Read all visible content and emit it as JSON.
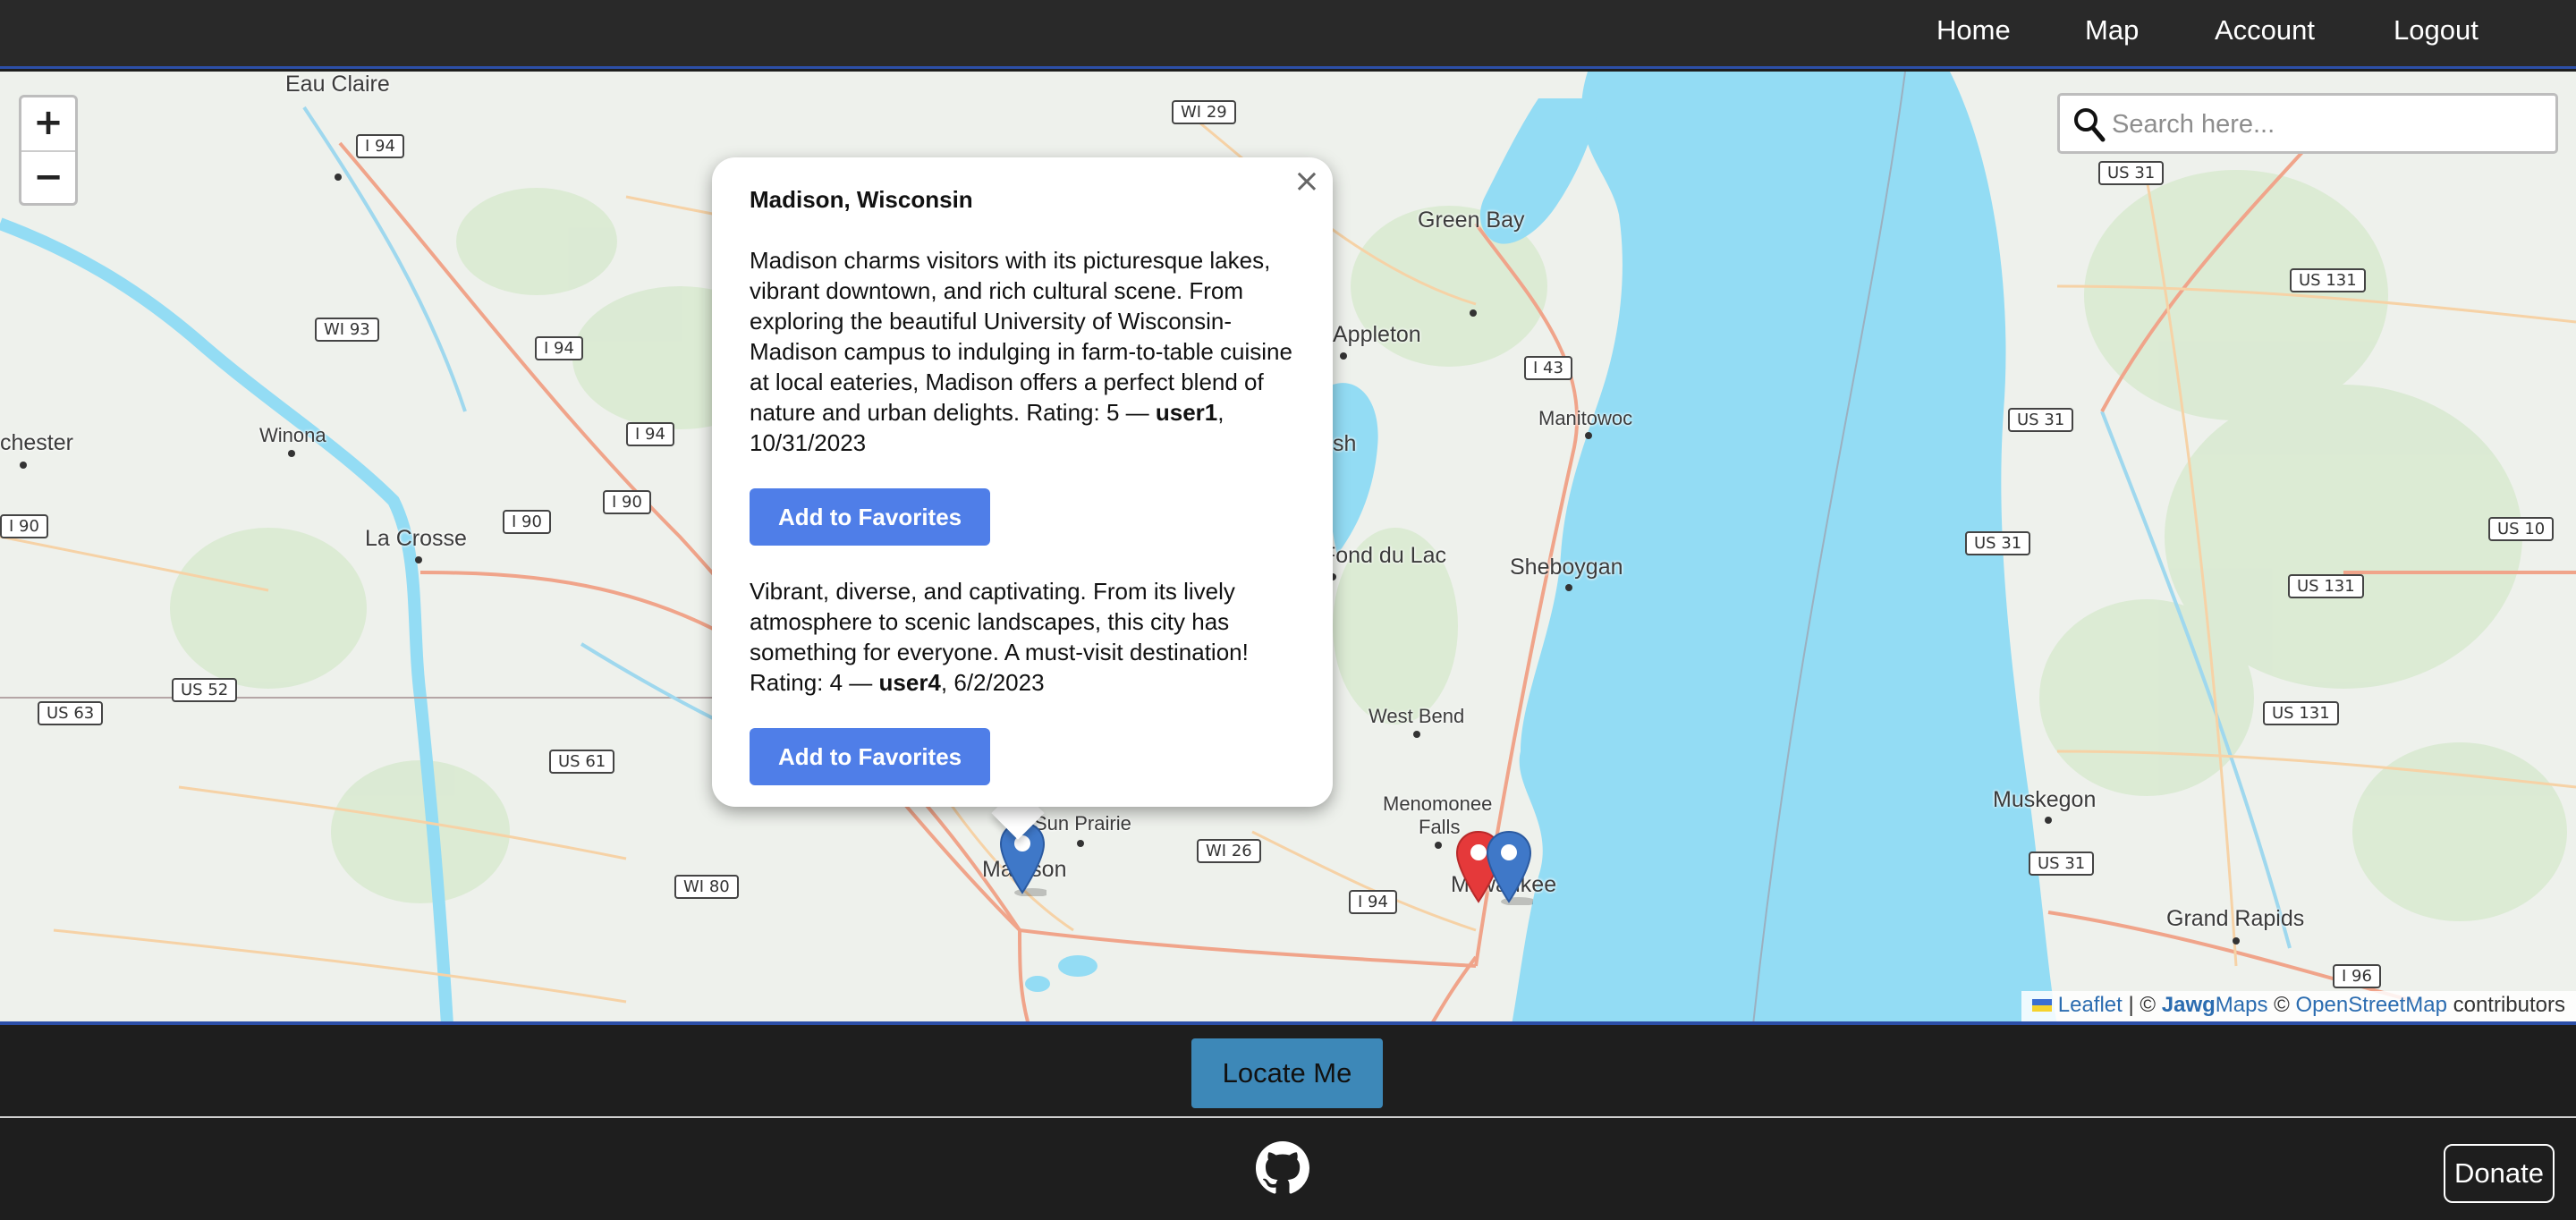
{
  "nav": {
    "items": [
      {
        "label": "Home"
      },
      {
        "label": "Map"
      },
      {
        "label": "Account"
      },
      {
        "label": "Logout"
      }
    ]
  },
  "map": {
    "zoom_in": "+",
    "zoom_out": "−",
    "search_placeholder": "Search here...",
    "places": [
      "Eau Claire",
      "Green Bay",
      "Appleton",
      "Manitowoc",
      "Winona",
      "chester",
      "La Crosse",
      "Fond du Lac",
      "Sheboygan",
      "West Bend",
      "Menomonee",
      "Falls",
      "Sun Prairie",
      "Madison",
      "Milwaukee",
      "Muskegon",
      "Grand Rapids",
      "sh"
    ],
    "shields": [
      "I 94",
      "WI 29",
      "WI 93",
      "I 94",
      "I 94",
      "I 90",
      "I 90",
      "I 90",
      "US 52",
      "US 63",
      "US 61",
      "WI 80",
      "WI 26",
      "I 94",
      "I 43",
      "US 31",
      "US 131",
      "US 31",
      "US 31",
      "US 10",
      "US 131",
      "US 131",
      "US 31",
      "I 96"
    ],
    "attribution": {
      "leaflet": "Leaflet",
      "sep": "| ©",
      "jawg_bold": "Jawg",
      "jawg_rest": "Maps",
      "copy": "©",
      "osm": "OpenStreetMap",
      "contrib": "contributors"
    }
  },
  "popup": {
    "close": "×",
    "title": "Madison, Wisconsin",
    "reviews": [
      {
        "text": "Madison charms visitors with its picturesque lakes, vibrant downtown, and rich cultural scene. From exploring the beautiful University of Wisconsin-Madison campus to indulging in farm-to-table cuisine at local eateries, Madison offers a perfect blend of nature and urban delights. Rating: 5 — ",
        "user": "user1",
        "date": ", 10/31/2023",
        "button": "Add to Favorites"
      },
      {
        "text": "Vibrant, diverse, and captivating. From its lively atmosphere to scenic landscapes, this city has something for everyone. A must-visit destination! Rating: 4 — ",
        "user": "user4",
        "date": ", 6/2/2023",
        "button": "Add to Favorites"
      }
    ]
  },
  "footer": {
    "locate": "Locate Me",
    "donate": "Donate"
  },
  "colors": {
    "nav_bg": "#292929",
    "water": "#93dcf4",
    "button_blue": "#4f7ee8",
    "locate_bg": "#3d88b8",
    "marker_blue": "#3f78c8",
    "marker_red": "#e5393a"
  }
}
